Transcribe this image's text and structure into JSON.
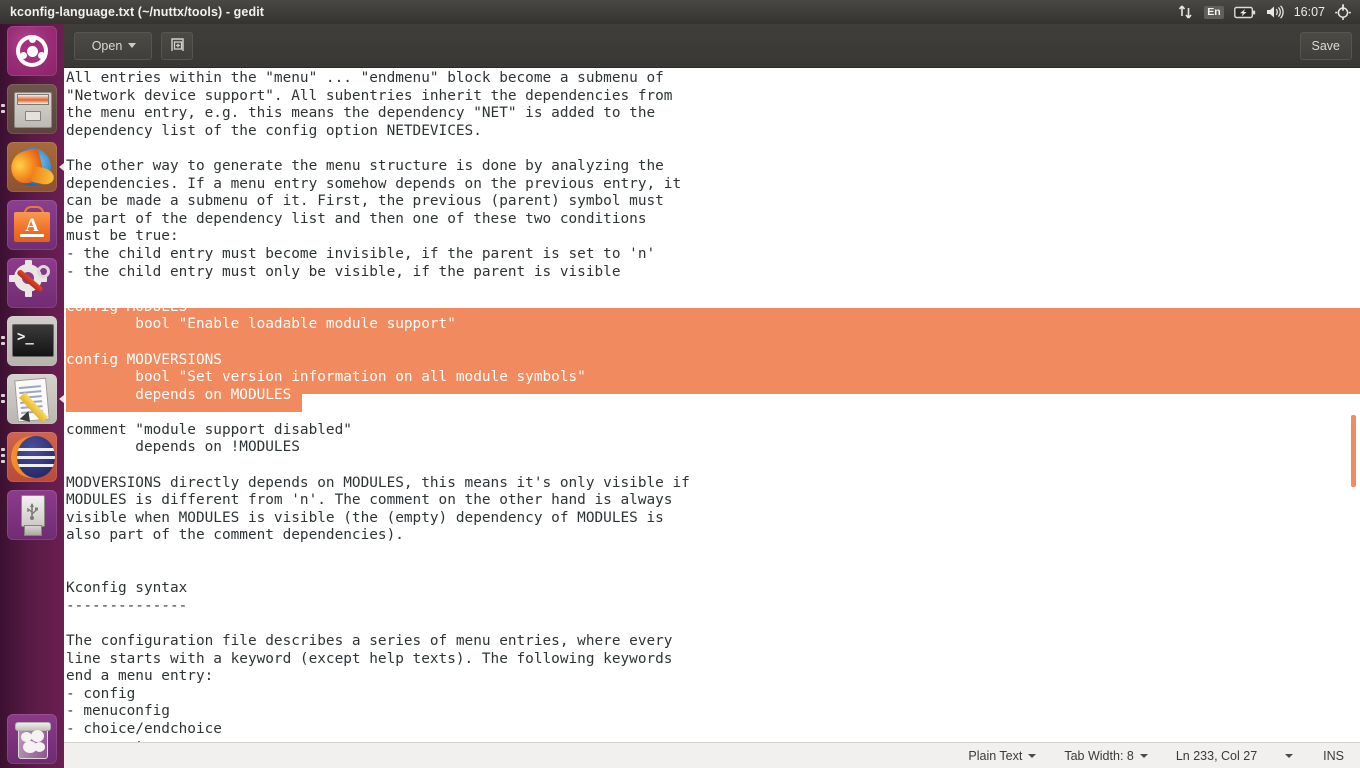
{
  "panel": {
    "window_title": "kconfig-language.txt (~/nuttx/tools) - gedit",
    "tray": {
      "network_icon": "network-updown-arrows-icon",
      "keyboard_layout": "En",
      "battery_icon": "battery-charging-icon",
      "volume_icon": "volume-speaker-icon",
      "clock": "16:07",
      "session_icon": "power-gear-icon"
    }
  },
  "launcher": {
    "items": [
      {
        "name": "ubuntu-dash",
        "label": "Dash Home",
        "running": false
      },
      {
        "name": "files",
        "label": "Files",
        "running": true
      },
      {
        "name": "firefox",
        "label": "Firefox Web Browser",
        "running": false
      },
      {
        "name": "software-center",
        "label": "Ubuntu Software Center",
        "running": false
      },
      {
        "name": "system-settings",
        "label": "System Settings",
        "running": false
      },
      {
        "name": "terminal",
        "label": "Terminal",
        "running": true
      },
      {
        "name": "gedit",
        "label": "Text Editor",
        "running": true
      },
      {
        "name": "eclipse",
        "label": "Eclipse",
        "running": true
      },
      {
        "name": "usb-drive",
        "label": "USB Drive",
        "running": false
      },
      {
        "name": "trash",
        "label": "Trash",
        "running": false
      }
    ]
  },
  "headerbar": {
    "open_label": "Open",
    "new_document_icon": "new-document-icon",
    "save_label": "Save"
  },
  "editor": {
    "language": "Plain Text",
    "content_before_selection": "All entries within the \"menu\" ... \"endmenu\" block become a submenu of\n\"Network device support\". All subentries inherit the dependencies from\nthe menu entry, e.g. this means the dependency \"NET\" is added to the\ndependency list of the config option NETDEVICES.\n\nThe other way to generate the menu structure is done by analyzing the\ndependencies. If a menu entry somehow depends on the previous entry, it\ncan be made a submenu of it. First, the previous (parent) symbol must\nbe part of the dependency list and then one of these two conditions\nmust be true:\n- the child entry must become invisible, if the parent is set to 'n'\n- the child entry must only be visible, if the parent is visible\n",
    "selection_text": "config MODULES\n        bool \"Enable loadable module support\"\n\nconfig MODVERSIONS\n        bool \"Set version information on all module symbols\"\n        depends on MODULES",
    "content_after_selection": "\n\ncomment \"module support disabled\"\n        depends on !MODULES\n\nMODVERSIONS directly depends on MODULES, this means it's only visible if\nMODULES is different from 'n'. The comment on the other hand is always\nvisible when MODULES is visible (the (empty) dependency of MODULES is\nalso part of the comment dependencies).\n\n\nKconfig syntax\n--------------\n\nThe configuration file describes a series of menu entries, where every\nline starts with a keyword (except help texts). The following keywords\nend a menu entry:\n- config\n- menuconfig\n- choice/endchoice\n- comment",
    "selection_color": "#f18a5e",
    "scrollbar_color": "#f08c63"
  },
  "statusbar": {
    "language_label": "Plain Text",
    "tab_width_label": "Tab Width: 8",
    "position_label": "Ln 233, Col 27",
    "insert_mode_label": "INS"
  }
}
